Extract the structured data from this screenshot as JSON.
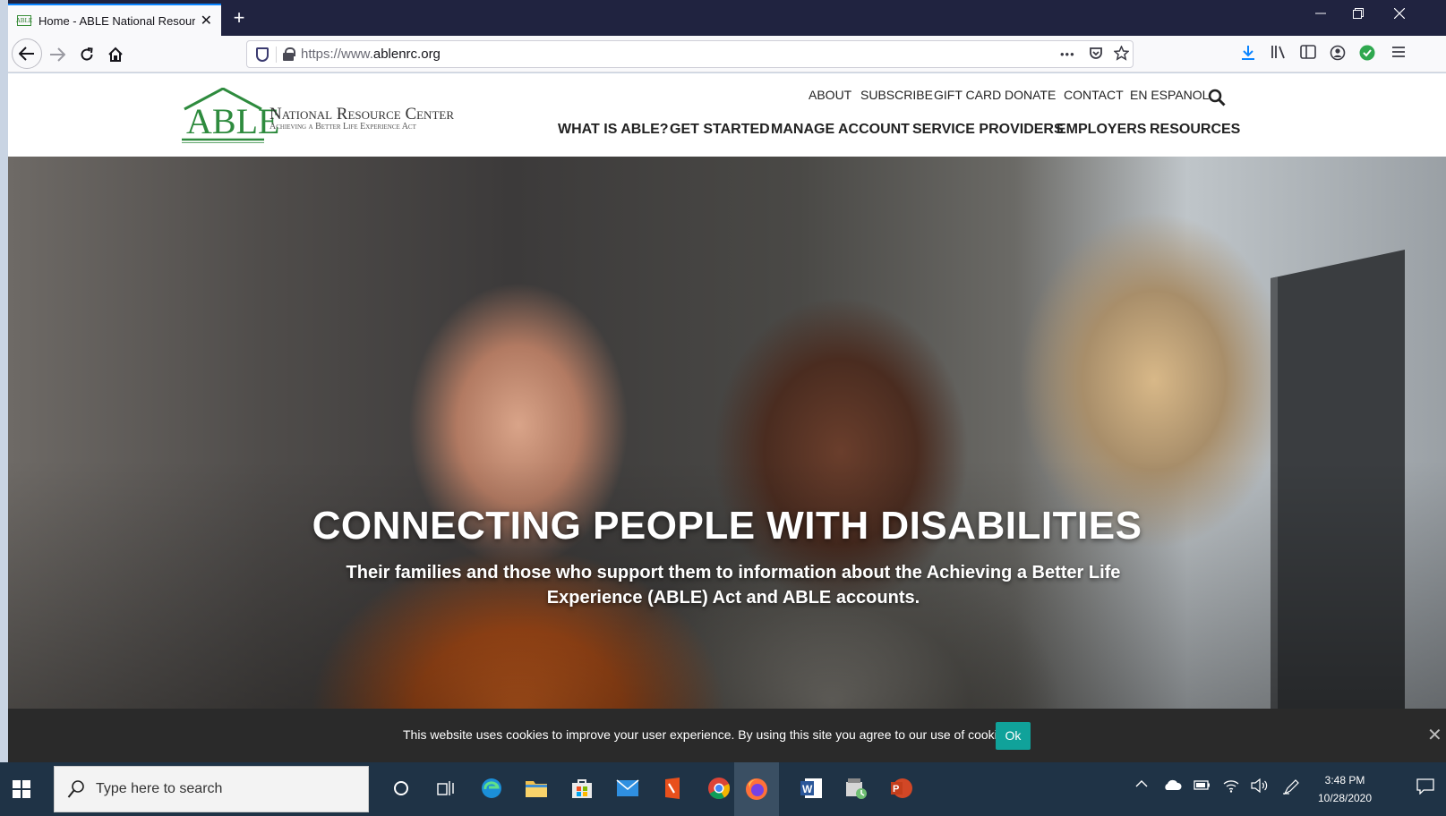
{
  "browser": {
    "tab_title": "Home - ABLE National Resource Center",
    "favicon_text": "ABLE",
    "url_prefix": "https://www.",
    "url_domain": "ablenrc.org",
    "new_tab": "+",
    "tab_close": "✕",
    "more_actions": "•••"
  },
  "site": {
    "logo": {
      "able": "ABLE",
      "name": "National Resource Center",
      "tagline": "Achieving a Better Life Experience Act"
    },
    "utility_nav": [
      "ABOUT",
      "SUBSCRIBE",
      "GIFT CARD",
      "DONATE",
      "CONTACT",
      "EN ESPANOL"
    ],
    "main_nav": [
      "WHAT IS ABLE?",
      "GET STARTED",
      "MANAGE ACCOUNT",
      "SERVICE PROVIDERS",
      "EMPLOYERS",
      "RESOURCES"
    ],
    "hero": {
      "title": "CONNECTING PEOPLE WITH DISABILITIES",
      "subtitle": "Their families and those who support them to information about the Achieving a Better Life Experience (ABLE) Act and ABLE accounts."
    },
    "cookie": {
      "message": "This website uses cookies to improve your user experience. By using this site you agree to our use of cookies.",
      "ok_label": "Ok",
      "close": "✕"
    }
  },
  "taskbar": {
    "search_placeholder": "Type here to search",
    "time": "3:48 PM",
    "date": "10/28/2020"
  },
  "colors": {
    "accent_blue": "#0a84ff",
    "able_green": "#2e8b3e",
    "cookie_ok": "#10a29a",
    "taskbar": "#1f3346"
  }
}
